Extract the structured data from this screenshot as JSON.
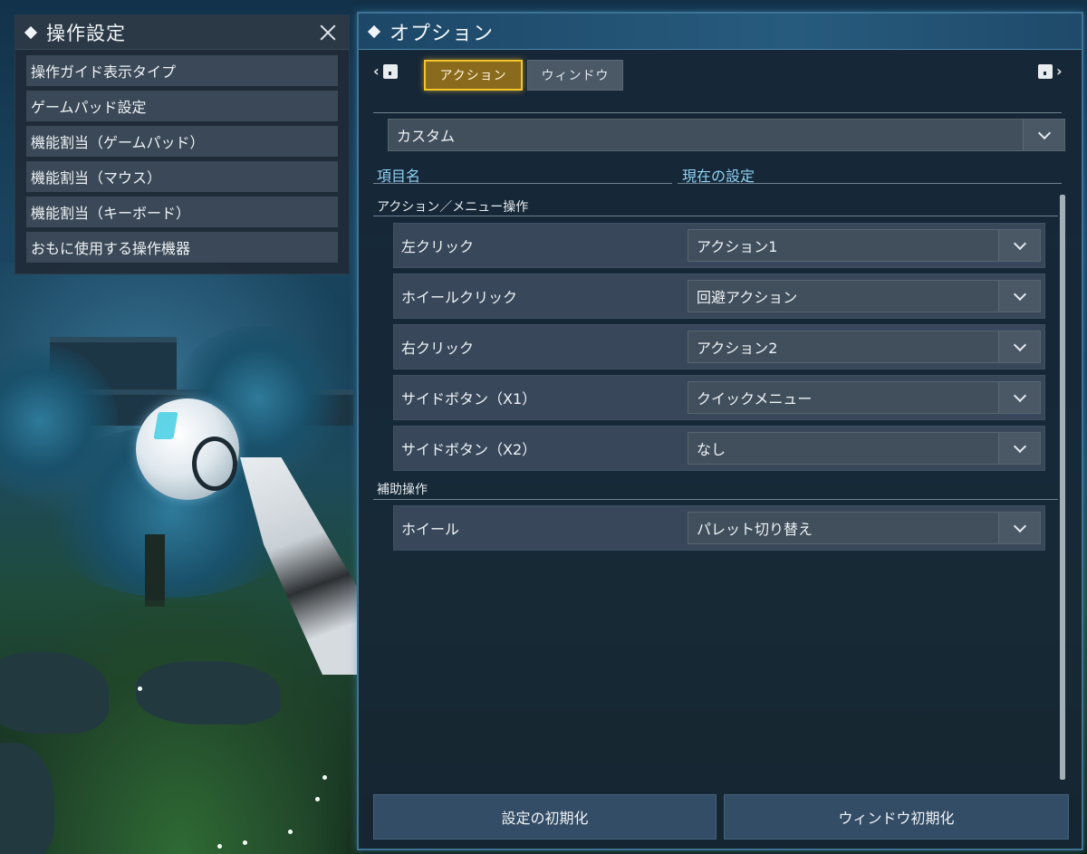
{
  "left_panel": {
    "title": "操作設定",
    "items": [
      {
        "label": "操作ガイド表示タイプ"
      },
      {
        "label": "ゲームパッド設定"
      },
      {
        "label": "機能割当（ゲームパッド）"
      },
      {
        "label": "機能割当（マウス）"
      },
      {
        "label": "機能割当（キーボード）"
      },
      {
        "label": "おもに使用する操作機器"
      }
    ]
  },
  "options": {
    "title": "オプション",
    "tabs": [
      {
        "label": "アクション",
        "active": true
      },
      {
        "label": "ウィンドウ",
        "active": false
      }
    ],
    "preset": {
      "value": "カスタム"
    },
    "columns": {
      "item_name": "項目名",
      "current_setting": "現在の設定"
    },
    "sections": [
      {
        "label": "アクション／メニュー操作",
        "rows": [
          {
            "label": "左クリック",
            "value": "アクション1"
          },
          {
            "label": "ホイールクリック",
            "value": "回避アクション"
          },
          {
            "label": "右クリック",
            "value": "アクション2"
          },
          {
            "label": "サイドボタン（X1）",
            "value": "クイックメニュー"
          },
          {
            "label": "サイドボタン（X2）",
            "value": "なし"
          }
        ]
      },
      {
        "label": "補助操作",
        "rows": [
          {
            "label": "ホイール",
            "value": "パレット切り替え"
          }
        ]
      }
    ],
    "buttons": {
      "reset_settings": "設定の初期化",
      "reset_window": "ウィンドウ初期化"
    }
  },
  "colors": {
    "accent_tab": "#f4c62a",
    "header_blue": "#275b7e",
    "column_header": "#8fd0f2"
  }
}
